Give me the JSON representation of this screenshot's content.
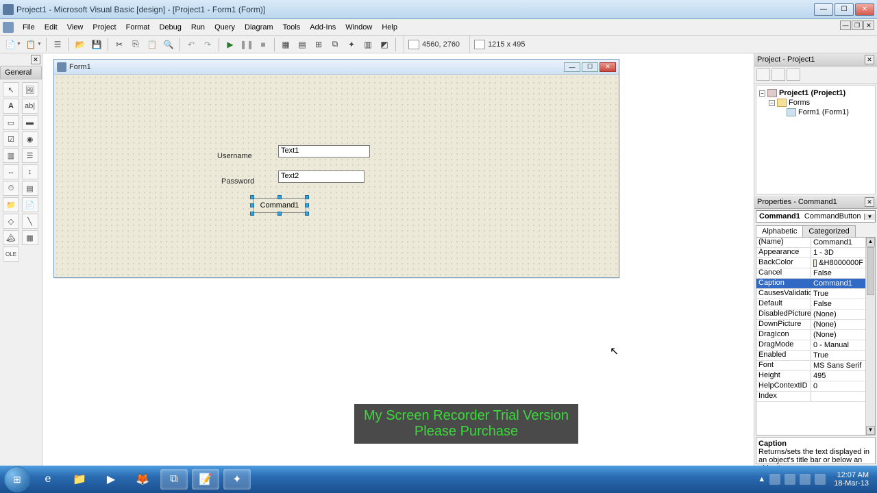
{
  "title": "Project1 - Microsoft Visual Basic [design] - [Project1 - Form1 (Form)]",
  "menus": [
    "File",
    "Edit",
    "View",
    "Project",
    "Format",
    "Debug",
    "Run",
    "Query",
    "Diagram",
    "Tools",
    "Add-Ins",
    "Window",
    "Help"
  ],
  "coords": "4560, 2760",
  "size": "1215 x 495",
  "toolbox_title": "General",
  "form": {
    "title": "Form1",
    "username_label": "Username",
    "password_label": "Password",
    "text1": "Text1",
    "text2": "Text2",
    "command1": "Command1"
  },
  "project_panel": {
    "title": "Project - Project1",
    "root": "Project1 (Project1)",
    "folder": "Forms",
    "item": "Form1 (Form1)"
  },
  "props_panel": {
    "title": "Properties - Command1",
    "combo_name": "Command1",
    "combo_type": "CommandButton",
    "tab_alpha": "Alphabetic",
    "tab_cat": "Categorized",
    "rows": [
      {
        "n": "(Name)",
        "v": "Command1"
      },
      {
        "n": "Appearance",
        "v": "1 - 3D"
      },
      {
        "n": "BackColor",
        "v": "&H8000000F",
        "c": true
      },
      {
        "n": "Cancel",
        "v": "False"
      },
      {
        "n": "Caption",
        "v": "Command1",
        "sel": true
      },
      {
        "n": "CausesValidation",
        "v": "True"
      },
      {
        "n": "Default",
        "v": "False"
      },
      {
        "n": "DisabledPicture",
        "v": "(None)"
      },
      {
        "n": "DownPicture",
        "v": "(None)"
      },
      {
        "n": "DragIcon",
        "v": "(None)"
      },
      {
        "n": "DragMode",
        "v": "0 - Manual"
      },
      {
        "n": "Enabled",
        "v": "True"
      },
      {
        "n": "Font",
        "v": "MS Sans Serif"
      },
      {
        "n": "Height",
        "v": "495"
      },
      {
        "n": "HelpContextID",
        "v": "0"
      },
      {
        "n": "Index",
        "v": ""
      }
    ],
    "desc_title": "Caption",
    "desc_text": "Returns/sets the text displayed in an object's title bar or below an object's"
  },
  "watermark": {
    "l1": "My Screen Recorder Trial Version",
    "l2": "Please Purchase"
  },
  "clock": {
    "time": "12:07 AM",
    "date": "18-Mar-13"
  }
}
